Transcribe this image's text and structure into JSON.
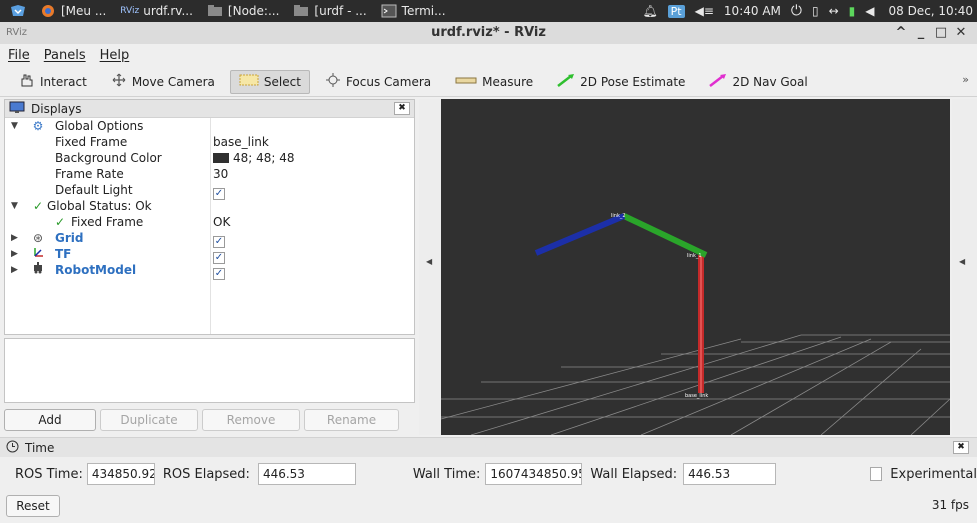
{
  "system_panel": {
    "tasks": [
      "[Meu ...",
      "urdf.rv...",
      "[Node:...",
      "[urdf - ...",
      "Termi..."
    ],
    "rviz_badge": "RViz",
    "input_method": "Pt",
    "clock": "10:40 AM",
    "date": "08 Dec, 10:40"
  },
  "window": {
    "title": "urdf.rviz* - RViz",
    "app_mark": "RViz",
    "controls": {
      "minimize": "_",
      "maximize": "□",
      "close": "✕",
      "shade": "^"
    }
  },
  "menu": [
    "File",
    "Panels",
    "Help"
  ],
  "toolbar": {
    "tools": [
      {
        "label": "Interact",
        "icon": "hand-icon",
        "active": false
      },
      {
        "label": "Move Camera",
        "icon": "move-camera-icon",
        "active": false
      },
      {
        "label": "Select",
        "icon": "select-icon",
        "active": true
      },
      {
        "label": "Focus Camera",
        "icon": "focus-camera-icon",
        "active": false
      },
      {
        "label": "Measure",
        "icon": "ruler-icon",
        "active": false
      },
      {
        "label": "2D Pose Estimate",
        "icon": "green-arrow-icon",
        "active": false
      },
      {
        "label": "2D Nav Goal",
        "icon": "magenta-arrow-icon",
        "active": false
      }
    ],
    "overflow": "»"
  },
  "displays": {
    "title": "Displays",
    "global_options": "Global Options",
    "fixed_frame_label": "Fixed Frame",
    "fixed_frame_value": "base_link",
    "background_color_label": "Background Color",
    "background_color_value": "48; 48; 48",
    "background_color_hex": "#303030",
    "frame_rate_label": "Frame Rate",
    "frame_rate_value": "30",
    "default_light_label": "Default Light",
    "global_status": "Global Status: Ok",
    "status_fixed_frame_label": "Fixed Frame",
    "status_fixed_frame_value": "OK",
    "grid": "Grid",
    "tf": "TF",
    "robot_model": "RobotModel"
  },
  "buttons": {
    "add": "Add",
    "duplicate": "Duplicate",
    "remove": "Remove",
    "rename": "Rename"
  },
  "view": {
    "frame_labels": [
      "base_link",
      "link_1",
      "link_2"
    ],
    "link_colors": [
      "#c42a2a",
      "#2aa52a",
      "#1c2fa8"
    ]
  },
  "time": {
    "title": "Time",
    "ros_time_label": "ROS Time:",
    "ros_time_value": "434850.92",
    "ros_elapsed_label": "ROS Elapsed:",
    "ros_elapsed_value": "446.53",
    "wall_time_label": "Wall Time:",
    "wall_time_value": "1607434850.95",
    "wall_elapsed_label": "Wall Elapsed:",
    "wall_elapsed_value": "446.53",
    "experimental_label": "Experimental",
    "reset_label": "Reset",
    "fps": "31 fps"
  }
}
